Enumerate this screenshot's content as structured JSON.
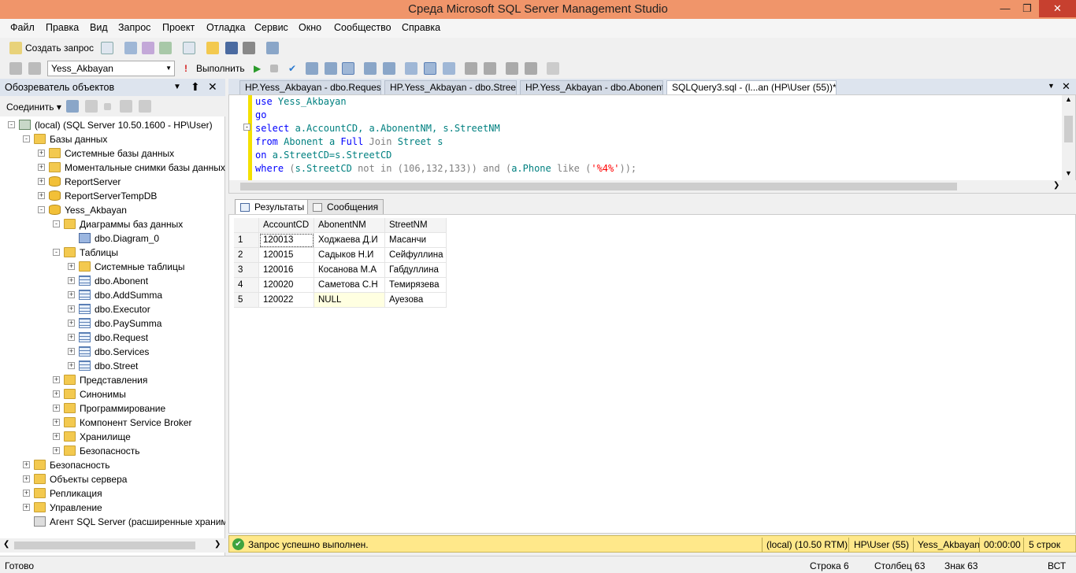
{
  "window": {
    "title": "Среда Microsoft SQL Server Management Studio"
  },
  "menu": [
    "Файл",
    "Правка",
    "Вид",
    "Запрос",
    "Проект",
    "Отладка",
    "Сервис",
    "Окно",
    "Сообщество",
    "Справка"
  ],
  "toolbar": {
    "new_query": "Создать запрос",
    "database": "Yess_Akbayan",
    "execute": "Выполнить"
  },
  "object_explorer": {
    "title": "Обозреватель объектов",
    "connect": "Соединить",
    "tree": [
      {
        "label": "(local) (SQL Server 10.50.1600 - HP\\User)",
        "level": 0,
        "icon": "server-icon",
        "expander": "-"
      },
      {
        "label": "Базы данных",
        "level": 1,
        "icon": "folder-icon",
        "expander": "-"
      },
      {
        "label": "Системные базы данных",
        "level": 2,
        "icon": "folder-icon",
        "expander": "+"
      },
      {
        "label": "Моментальные снимки базы данных",
        "level": 2,
        "icon": "folder-icon",
        "expander": "+"
      },
      {
        "label": "ReportServer",
        "level": 2,
        "icon": "database-icon",
        "expander": "+"
      },
      {
        "label": "ReportServerTempDB",
        "level": 2,
        "icon": "database-icon",
        "expander": "+"
      },
      {
        "label": "Yess_Akbayan",
        "level": 2,
        "icon": "database-icon",
        "expander": "-"
      },
      {
        "label": "Диаграммы баз данных",
        "level": 3,
        "icon": "folder-icon",
        "expander": "-"
      },
      {
        "label": "dbo.Diagram_0",
        "level": 4,
        "icon": "diagram-icon",
        "expander": ""
      },
      {
        "label": "Таблицы",
        "level": 3,
        "icon": "folder-icon",
        "expander": "-"
      },
      {
        "label": "Системные таблицы",
        "level": 4,
        "icon": "folder-icon",
        "expander": "+"
      },
      {
        "label": "dbo.Abonent",
        "level": 4,
        "icon": "table-icon",
        "expander": "+"
      },
      {
        "label": "dbo.AddSumma",
        "level": 4,
        "icon": "table-icon",
        "expander": "+"
      },
      {
        "label": "dbo.Executor",
        "level": 4,
        "icon": "table-icon",
        "expander": "+"
      },
      {
        "label": "dbo.PaySumma",
        "level": 4,
        "icon": "table-icon",
        "expander": "+"
      },
      {
        "label": "dbo.Request",
        "level": 4,
        "icon": "table-icon",
        "expander": "+"
      },
      {
        "label": "dbo.Services",
        "level": 4,
        "icon": "table-icon",
        "expander": "+"
      },
      {
        "label": "dbo.Street",
        "level": 4,
        "icon": "table-icon",
        "expander": "+"
      },
      {
        "label": "Представления",
        "level": 3,
        "icon": "folder-icon",
        "expander": "+"
      },
      {
        "label": "Синонимы",
        "level": 3,
        "icon": "folder-icon",
        "expander": "+"
      },
      {
        "label": "Программирование",
        "level": 3,
        "icon": "folder-icon",
        "expander": "+"
      },
      {
        "label": "Компонент Service Broker",
        "level": 3,
        "icon": "folder-icon",
        "expander": "+"
      },
      {
        "label": "Хранилище",
        "level": 3,
        "icon": "folder-icon",
        "expander": "+"
      },
      {
        "label": "Безопасность",
        "level": 3,
        "icon": "folder-icon",
        "expander": "+"
      },
      {
        "label": "Безопасность",
        "level": 1,
        "icon": "folder-icon",
        "expander": "+"
      },
      {
        "label": "Объекты сервера",
        "level": 1,
        "icon": "folder-icon",
        "expander": "+"
      },
      {
        "label": "Репликация",
        "level": 1,
        "icon": "folder-icon",
        "expander": "+"
      },
      {
        "label": "Управление",
        "level": 1,
        "icon": "folder-icon",
        "expander": "+"
      },
      {
        "label": "Агент SQL Server (расширенные хранимые процедуры)",
        "level": 1,
        "icon": "agent-icon",
        "expander": ""
      }
    ]
  },
  "tabs": [
    {
      "label": "HP.Yess_Akbayan - dbo.Request",
      "active": false
    },
    {
      "label": "HP.Yess_Akbayan - dbo.Street",
      "active": false
    },
    {
      "label": "HP.Yess_Akbayan - dbo.Abonent",
      "active": false
    },
    {
      "label": "SQLQuery3.sql - (l...an (HP\\User (55))*",
      "active": true
    }
  ],
  "editor": {
    "lines": [
      "use Yess_Akbayan",
      "go",
      "select a.AccountCD, a.AbonentNM, s.StreetNM",
      "from Abonent a Full Join Street s",
      "on a.StreetCD=s.StreetCD",
      "where (s.StreetCD not in (106,132,133)) and (a.Phone like ('%4%'));"
    ]
  },
  "results": {
    "tabs": [
      "Результаты",
      "Сообщения"
    ],
    "columns": [
      "AccountCD",
      "AbonentNM",
      "StreetNM"
    ],
    "rows": [
      [
        "1",
        "120013",
        "Ходжаева Д.И",
        "Масанчи"
      ],
      [
        "2",
        "120015",
        "Садыков Н.И",
        "Сейфуллина"
      ],
      [
        "3",
        "120016",
        "Косанова М.А",
        "Габдуллина"
      ],
      [
        "4",
        "120020",
        "Саметова С.Н",
        "Темирязева"
      ],
      [
        "5",
        "120022",
        "NULL",
        "Ауезова"
      ]
    ]
  },
  "query_status": {
    "message": "Запрос успешно выполнен.",
    "server": "(local) (10.50 RTM)",
    "user": "HP\\User (55)",
    "database": "Yess_Akbayan",
    "time": "00:00:00",
    "rows": "5 строк"
  },
  "status_bar": {
    "ready": "Готово",
    "line": "Строка 6",
    "column": "Столбец 63",
    "char": "Знак 63",
    "mode": "ВСТ"
  },
  "colors": {
    "title_bar": "#f0956a",
    "query_status": "#ffe88a",
    "close_button": "#c7402f"
  }
}
